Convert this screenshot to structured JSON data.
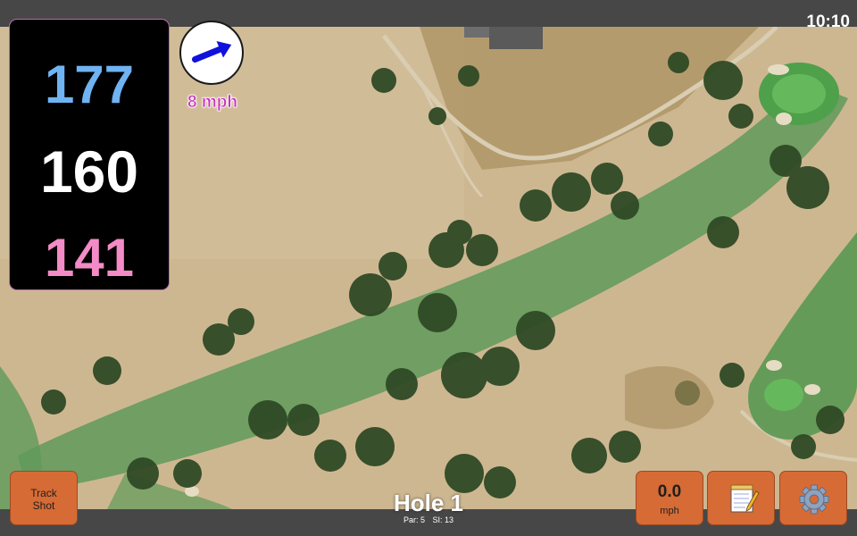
{
  "status_bar": {
    "time": "10:10"
  },
  "distances": {
    "back": "177",
    "center": "160",
    "front": "141",
    "colors": {
      "back": "#6fb3f2",
      "center": "#ffffff",
      "front": "#f28bc6"
    }
  },
  "wind": {
    "speed": "8 mph",
    "arrow_color": "#1111dd",
    "speed_color": "#c535b8",
    "direction_icon": "wind-arrow-icon"
  },
  "buttons": {
    "track_shot": "Track Shot",
    "speed": {
      "value": "0.0",
      "unit": "mph"
    },
    "notes_icon": "notepad-icon",
    "settings_icon": "gear-icon"
  },
  "hole": {
    "title": "Hole 1",
    "par": "Par: 5",
    "si": "SI: 13"
  },
  "colors": {
    "button": "#d66b35",
    "fairway": "#5f9a5a",
    "green": "#4fa04a",
    "rough": "#c9b48c"
  }
}
